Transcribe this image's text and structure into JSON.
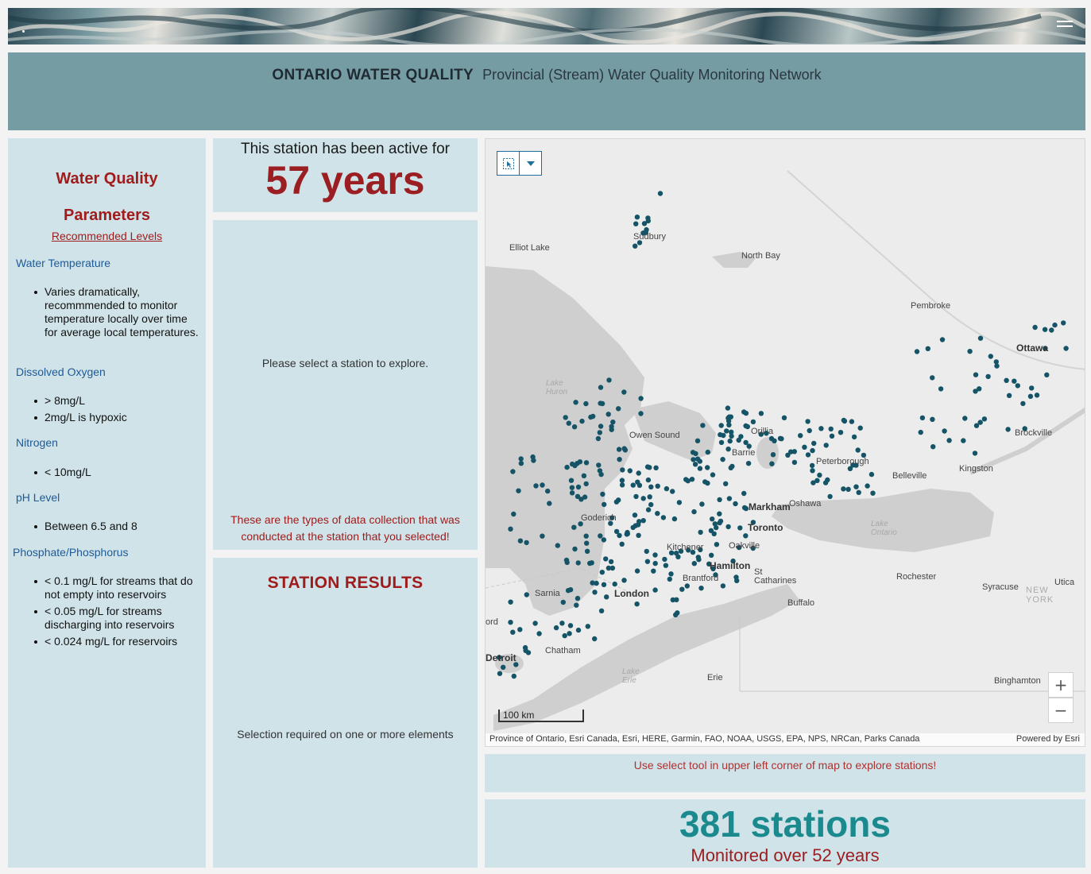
{
  "header": {
    "title": "ONTARIO WATER QUALITY",
    "subtitle": "Provincial (Stream) Water Quality Monitoring Network"
  },
  "parameters": {
    "heading1": "Water Quality",
    "heading2": "Parameters",
    "recommended_link": "Recommended Levels",
    "groups": [
      {
        "name": "Water Temperature",
        "items": [
          "Varies dramatically, recommmended to monitor temperature locally over time for average local temperatures."
        ]
      },
      {
        "name": "Dissolved Oxygen",
        "items": [
          "> 8mg/L",
          "2mg/L is hypoxic"
        ]
      },
      {
        "name": "Nitrogen",
        "items": [
          "< 10mg/L"
        ]
      },
      {
        "name": "pH Level",
        "items": [
          "Between 6.5 and 8"
        ]
      },
      {
        "name": "Phosphate/Phosphorus",
        "items": [
          "< 0.1 mg/L for streams that do not empty into reservoirs",
          "< 0.05 mg/L for streams discharging into reservoirs",
          "< 0.024 mg/L for reservoirs"
        ]
      }
    ]
  },
  "active": {
    "label": "This station has been active for",
    "value": "57 years"
  },
  "explore": {
    "message": "Please select a station to explore.",
    "note": "These are the types of data collection that was conducted at the station that you selected!"
  },
  "results": {
    "heading": "STATION RESULTS",
    "message": "Selection required on one or more elements"
  },
  "map": {
    "labels": {
      "elliot_lake": "Elliot Lake",
      "sudbury": "Sudbury",
      "north_bay": "North Bay",
      "pembroke": "Pembroke",
      "ottawa": "Ottawa",
      "lake_huron": "Lake Huron",
      "orillia": "Orillia",
      "owen_sound": "Owen Sound",
      "barrie": "Barrie",
      "peterborough": "Peterborough",
      "belleville": "Belleville",
      "kingston": "Kingston",
      "brockville": "Brockville",
      "goderich": "Goderich",
      "markham": "Markham",
      "oshawa": "Oshawa",
      "toronto": "Toronto",
      "lake_ontario": "Lake Ontario",
      "kitchener": "Kitchener",
      "oakville": "Oakville",
      "hamilton": "Hamilton",
      "brantford": "Brantford",
      "st_catharines": "St Catharines",
      "rochester": "Rochester",
      "syracuse": "Syracuse",
      "utica": "Utica",
      "new_york": "NEW YORK",
      "sarnia": "Sarnia",
      "london": "London",
      "buffalo": "Buffalo",
      "ord": "ord",
      "detroit": "Detroit",
      "chatham": "Chatham",
      "lake_erie": "Lake Erie",
      "erie": "Erie",
      "binghamton": "Binghamton"
    },
    "scale": "100 km",
    "attribution": "Province of Ontario, Esri Canada, Esri, HERE, Garmin, FAO, NOAA, USGS, EPA, NPS, NRCan, Parks Canada",
    "powered_by": "Powered by Esri",
    "zoom_in": "+",
    "zoom_out": "−",
    "station_color": "#155466"
  },
  "hint": {
    "text": "Use select tool in upper left corner of map to explore stations!"
  },
  "stations": {
    "count": "381 stations",
    "subtitle": "Monitored over 52 years"
  },
  "colors": {
    "header_bg": "#769ca3",
    "panel_bg": "#d0e3e8",
    "accent_red": "#9b1e22",
    "accent_teal": "#1a8a8e"
  }
}
